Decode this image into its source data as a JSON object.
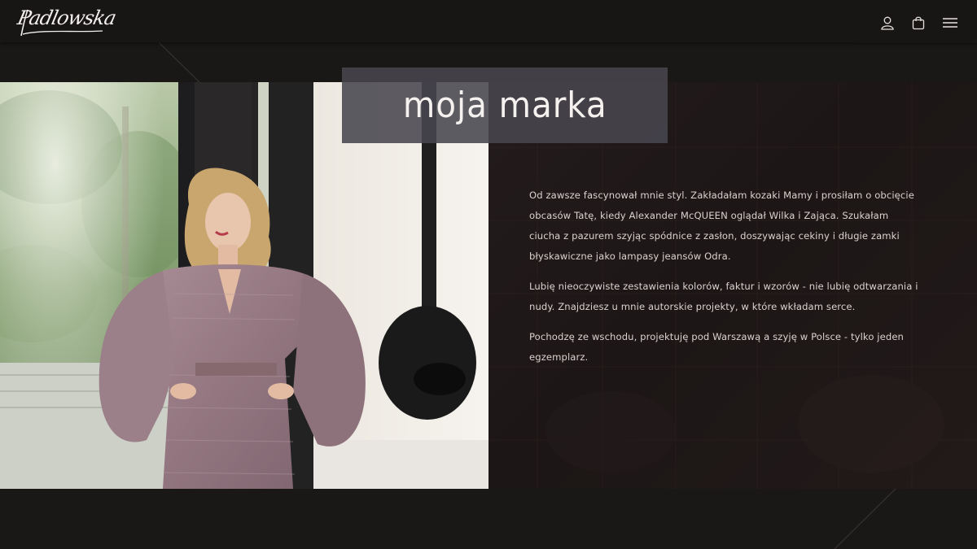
{
  "header": {
    "logo_text": "Padlowska",
    "icons": [
      "user-icon",
      "shopping-bag-icon",
      "hamburger-menu-icon"
    ]
  },
  "hero": {
    "title": "moja marka",
    "photo_description_icon": "portrait-photo"
  },
  "story": {
    "paragraphs": [
      "Od zawsze fascynował mnie styl. Zakładałam kozaki Mamy i prosiłam o obcięcie obcasów Tatę, kiedy Alexander McQUEEN oglądał Wilka i Zająca. Szukałam ciucha z pazurem szyjąc spódnice z zasłon, doszywając cekiny i długie zamki błyskawiczne jako lampasy jeansów Odra.",
      "Lubię nieoczywiste zestawienia kolorów, faktur i wzorów - nie lubię odtwarzania i nudy. Znajdziesz u mnie autorskie projekty, w które wkładam serce.",
      "Pochodzę ze wschodu, projektuję pod Warszawą a szyję w Polsce - tylko jeden egzemplarz."
    ]
  },
  "colors": {
    "background": "#1a1717",
    "header": "#181515",
    "title_box": "#48464e",
    "text": "#d9d2cf",
    "dress": "#9c7f88"
  }
}
